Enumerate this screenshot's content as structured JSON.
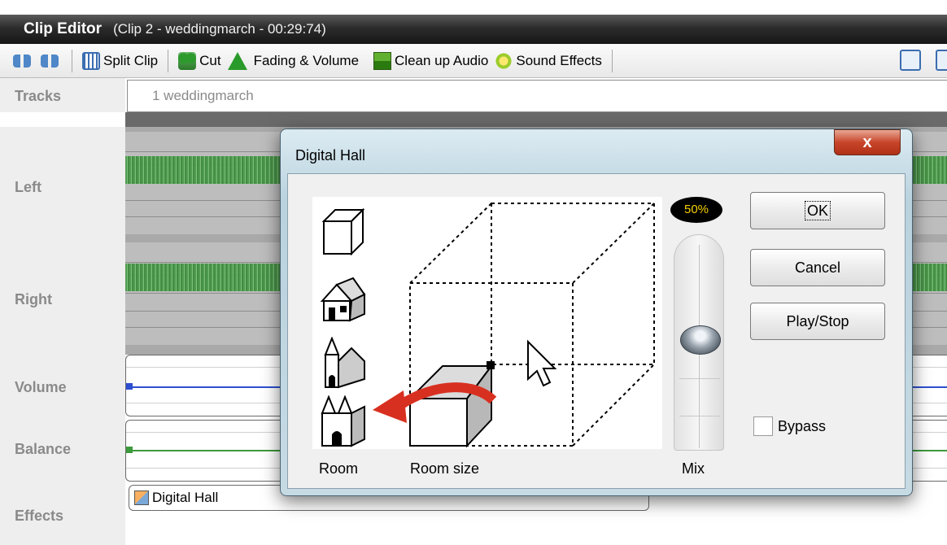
{
  "window": {
    "app_title": "Clip Editor",
    "clip_info": "(Clip 2 - weddingmarch - 00:29:74)"
  },
  "toolbar": {
    "split_clip": "Split Clip",
    "cut": "Cut",
    "fading_volume": "Fading & Volume",
    "clean_up_audio": "Clean up Audio",
    "sound_effects": "Sound Effects"
  },
  "tracks": {
    "header_label": "Tracks",
    "track_name": "1 weddingmarch",
    "left_label": "Left",
    "right_label": "Right",
    "volume_label": "Volume",
    "balance_label": "Balance",
    "effects_label": "Effects",
    "effect_chip": "Digital Hall"
  },
  "dialog": {
    "title": "Digital Hall",
    "close": "x",
    "room_label": "Room",
    "room_size_label": "Room size",
    "mix_label": "Mix",
    "mix_value": "50%",
    "ok": "OK",
    "cancel": "Cancel",
    "play_stop": "Play/Stop",
    "bypass": "Bypass"
  },
  "icons": [
    "back-icon",
    "forward-icon",
    "split-icon",
    "cut-icon",
    "fade-icon",
    "clean-audio-icon",
    "sound-effects-icon",
    "zoom-icon",
    "cube-room-icon",
    "house-icon",
    "church-icon",
    "cathedral-icon",
    "mouse-cursor-icon"
  ],
  "colors": {
    "waveform": "#4a9a4a",
    "volume_line": "#2d4fd0",
    "balance_line": "#3c9a3c",
    "close_button": "#c8452a"
  }
}
